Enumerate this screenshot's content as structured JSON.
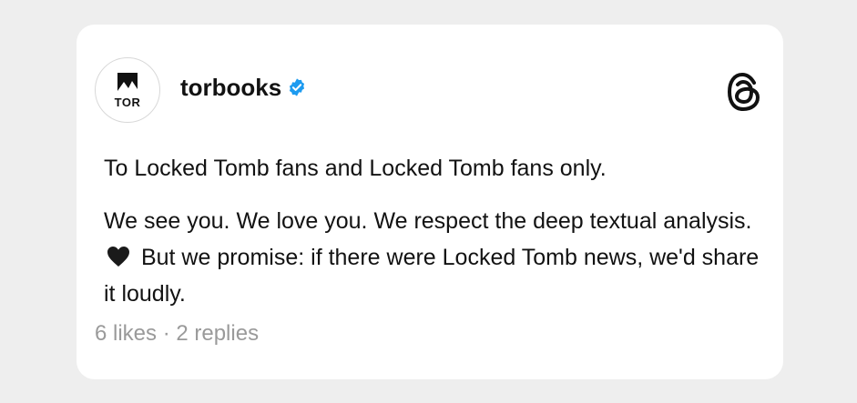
{
  "post": {
    "author": {
      "avatar_logo_text": "TOR",
      "username": "torbooks",
      "verified": true,
      "verified_icon": "verified-badge-icon"
    },
    "app_icon": "threads-icon",
    "paragraphs": [
      "To Locked Tomb fans and Locked Tomb fans only.",
      "We see you. We love you. We respect the deep textual analysis. 🖤 But we promise: if there were Locked Tomb news, we'd share it loudly."
    ],
    "body_before_heart": "We see you. We love you. We respect the deep textual analysis.",
    "body_after_heart": "But we promise: if there were Locked Tomb news, we'd share it loudly.",
    "emoji_icon": "black-heart-icon",
    "meta": "6 likes · 2 replies"
  },
  "colors": {
    "background": "#eeeeee",
    "card": "#ffffff",
    "text": "#121212",
    "meta_text": "#9a9a9a",
    "verified_blue": "#1d9bf0"
  }
}
